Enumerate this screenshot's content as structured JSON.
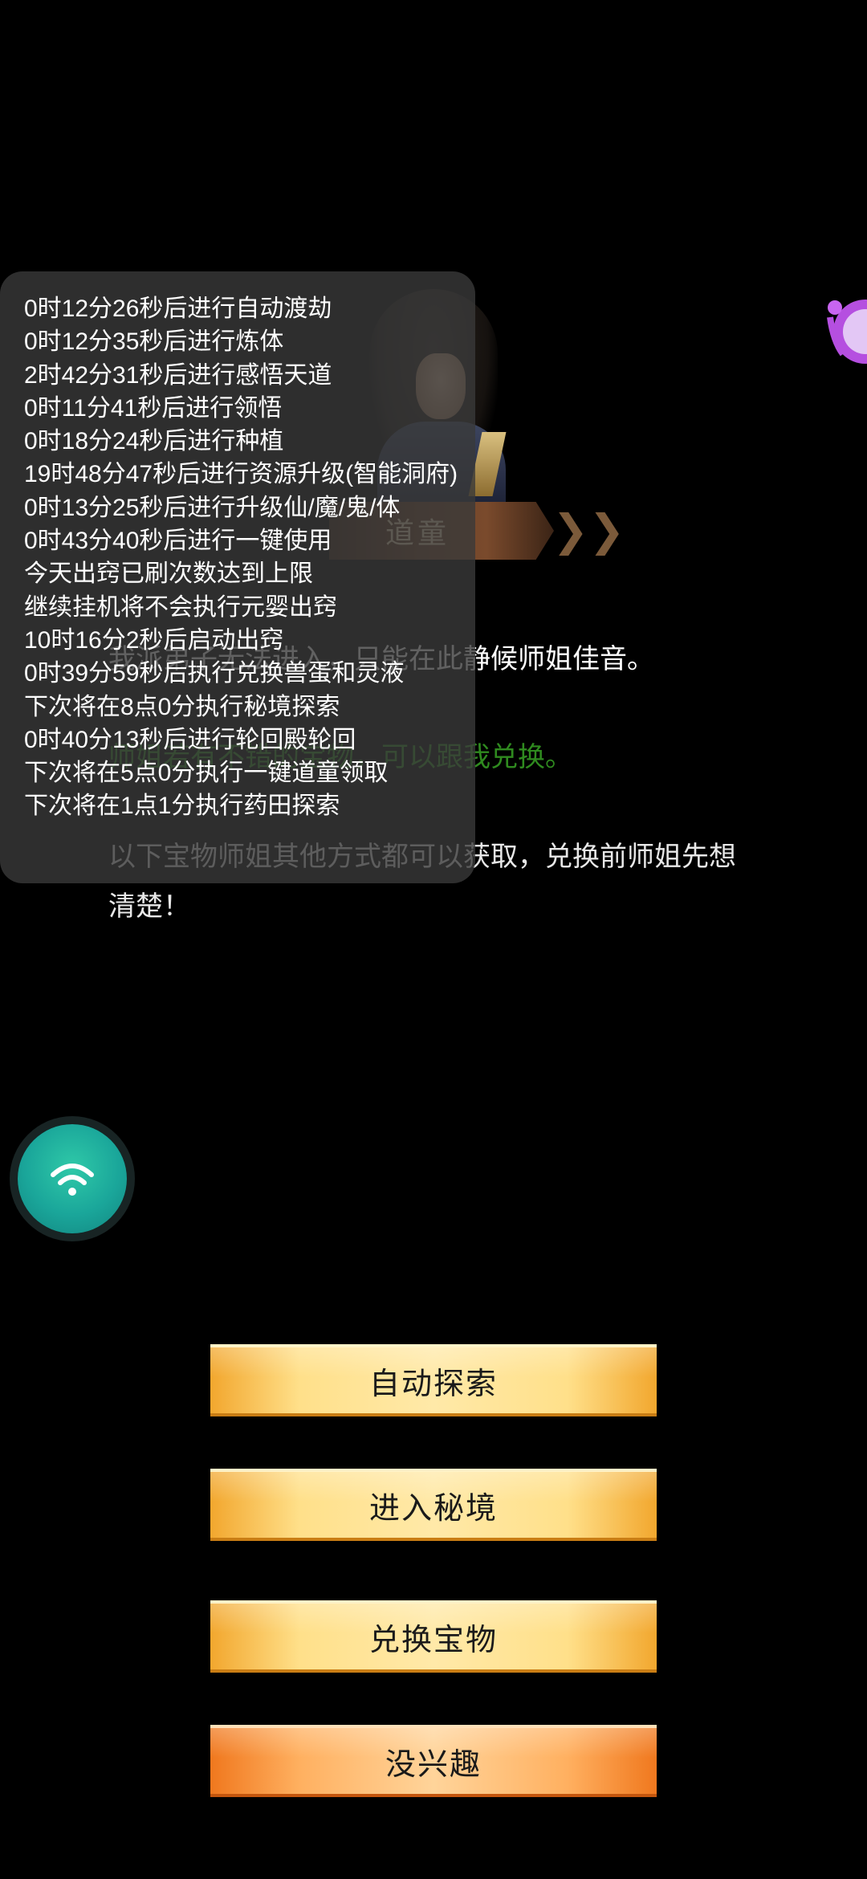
{
  "npc": {
    "name": "道童"
  },
  "dialog": {
    "line1": "我派弟子无法进入，只能在此静候师姐佳音。",
    "line2": "师姐若有不错的宝物，可以跟我兑换。",
    "line3": "以下宝物师姐其他方式都可以获取，兑换前师姐先想清楚！"
  },
  "log": {
    "lines": [
      "0时12分26秒后进行自动渡劫",
      "0时12分35秒后进行炼体",
      "2时42分31秒后进行感悟天道",
      "0时11分41秒后进行领悟",
      "0时18分24秒后进行种植",
      "19时48分47秒后进行资源升级(智能洞府)",
      "0时13分25秒后进行升级仙/魔/鬼/体",
      "0时43分40秒后进行一键使用",
      "今天出窍已刷次数达到上限",
      "继续挂机将不会执行元婴出窍",
      "10时16分2秒后启动出窍",
      "0时39分59秒后执行兑换兽蛋和灵液",
      "下次将在8点0分执行秘境探索",
      "0时40分13秒后进行轮回殿轮回",
      "下次将在5点0分执行一键道童领取",
      "下次将在1点1分执行药田探索"
    ]
  },
  "buttons": {
    "auto_explore": "自动探索",
    "enter_realm": "进入秘境",
    "exchange": "兑换宝物",
    "not_interested": "没兴趣"
  },
  "icons": {
    "wifi": "wifi-icon",
    "float_assistant": "assistant-float-icon",
    "chevron": "double-chevron-right-icon"
  },
  "colors": {
    "background": "#000000",
    "dialog_text": "#ffffff",
    "dialog_highlight": "#2f8a1f",
    "button_gold": "#ffe08a",
    "button_orange": "#ffb060",
    "fab_teal": "#1aa69a"
  }
}
